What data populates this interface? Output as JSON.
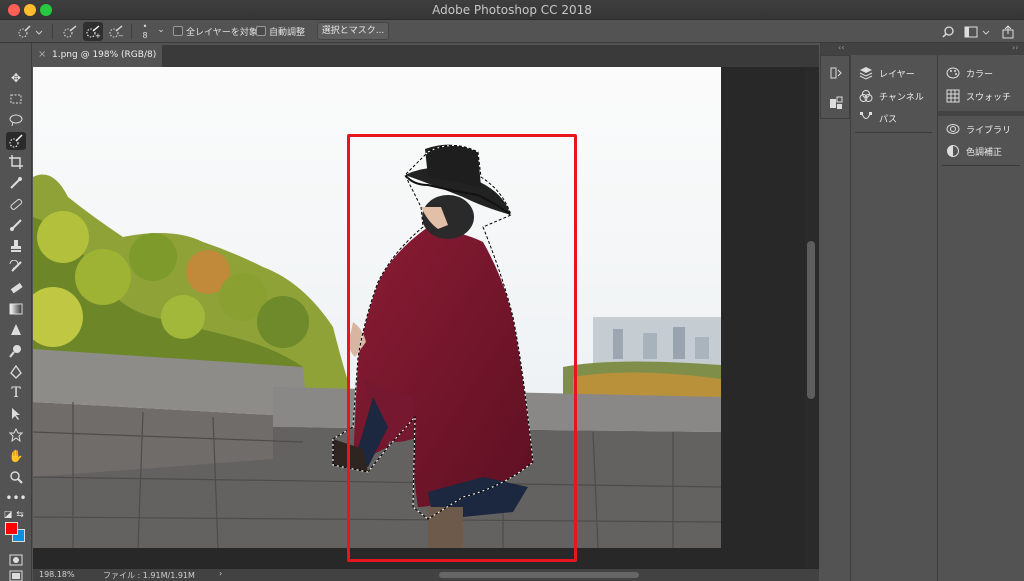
{
  "window": {
    "title": "Adobe Photoshop CC 2018"
  },
  "options_bar": {
    "brush_size": "8",
    "sample_all_layers_label": "全レイヤーを対象",
    "auto_enhance_label": "自動調整",
    "select_and_mask_label": "選択とマスク..."
  },
  "document": {
    "tab_title": "1.png @ 198% (RGB/8)",
    "close_glyph": "×"
  },
  "status": {
    "zoom": "198.18%",
    "file_info": "ファイル : 1.91M/1.91M",
    "arrow": "›"
  },
  "panels": {
    "group1": [
      {
        "label": "レイヤー",
        "icon": "layers-icon"
      },
      {
        "label": "チャンネル",
        "icon": "channels-icon"
      },
      {
        "label": "パス",
        "icon": "paths-icon"
      }
    ],
    "group2": [
      {
        "label": "カラー",
        "icon": "palette-icon"
      },
      {
        "label": "スウォッチ",
        "icon": "swatches-icon"
      }
    ],
    "group3": [
      {
        "label": "ライブラリ",
        "icon": "libraries-icon"
      },
      {
        "label": "色調補正",
        "icon": "adjustments-icon"
      }
    ]
  },
  "colors": {
    "foreground": "#ff0000",
    "background": "#0a8fe0",
    "selection_highlight": "#e8141e"
  }
}
